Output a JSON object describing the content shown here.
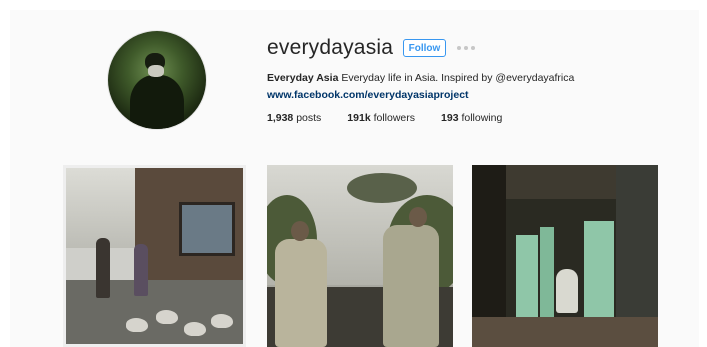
{
  "profile": {
    "username": "everydayasia",
    "follow_label": "Follow",
    "more_icon": "ellipsis-icon",
    "bio_name": "Everyday Asia",
    "bio_text": " Everyday life in Asia. Inspired by @everydayafrica",
    "website": "www.facebook.com/everydayasiaproject",
    "posts_count": "1,938",
    "posts_label": " posts",
    "followers_count": "191k",
    "followers_label": " followers",
    "following_count": "193",
    "following_label": " following"
  },
  "colors": {
    "accent": "#3897f0",
    "link": "#003569",
    "text": "#262626",
    "background": "#fafafa"
  }
}
